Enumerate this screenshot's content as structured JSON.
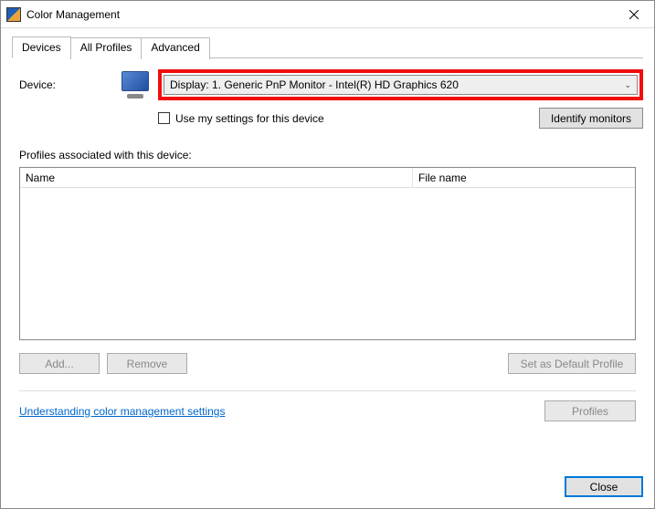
{
  "window": {
    "title": "Color Management"
  },
  "tabs": {
    "devices": "Devices",
    "allProfiles": "All Profiles",
    "advanced": "Advanced"
  },
  "device": {
    "label": "Device:",
    "selected": "Display: 1. Generic PnP Monitor - Intel(R) HD Graphics 620",
    "useMySettings": "Use my settings for this device",
    "identify": "Identify monitors"
  },
  "profiles": {
    "associatedLabel": "Profiles associated with this device:",
    "col1": "Name",
    "col2": "File name"
  },
  "buttons": {
    "add": "Add...",
    "remove": "Remove",
    "setDefault": "Set as Default Profile",
    "profiles": "Profiles",
    "close": "Close"
  },
  "link": {
    "understanding": "Understanding color management settings"
  }
}
